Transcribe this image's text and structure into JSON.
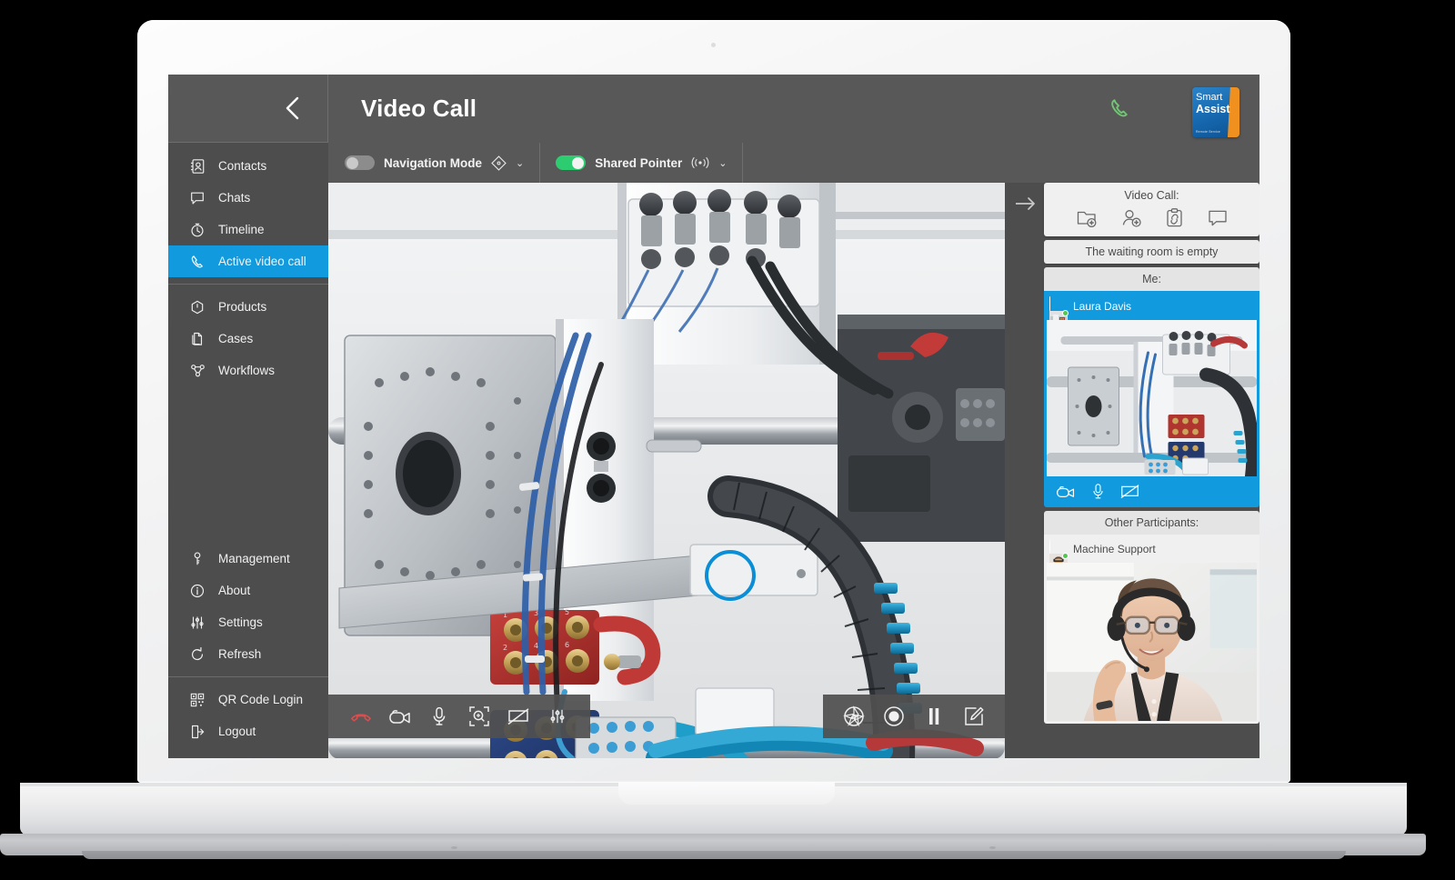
{
  "app": {
    "header": {
      "title": "Video Call",
      "back_icon": "chevron-left-icon",
      "phone_icon": "phone-active-icon",
      "logo": {
        "line1": "Smart",
        "line2": "Assist",
        "subtitle": "Remote Service"
      }
    },
    "toolbar": {
      "items": [
        {
          "label": "Navigation Mode",
          "state": "off",
          "icon": "navigation-diamond-icon",
          "chevron": "⌄"
        },
        {
          "label": "Shared Pointer",
          "state": "on",
          "icon": "pointer-waves-icon",
          "chevron": "⌄"
        }
      ]
    },
    "sidebar": {
      "primary": [
        {
          "label": "Contacts",
          "icon": "contacts-icon",
          "active": false
        },
        {
          "label": "Chats",
          "icon": "chat-bubble-icon",
          "active": false
        },
        {
          "label": "Timeline",
          "icon": "clock-icon",
          "active": false
        },
        {
          "label": "Active video call",
          "icon": "phone-handset-icon",
          "active": true
        }
      ],
      "secondary": [
        {
          "label": "Products",
          "icon": "product-hex-icon"
        },
        {
          "label": "Cases",
          "icon": "documents-icon"
        },
        {
          "label": "Workflows",
          "icon": "workflow-icon"
        }
      ],
      "tertiary": [
        {
          "label": "Management",
          "icon": "key-icon"
        },
        {
          "label": "About",
          "icon": "info-circle-icon"
        },
        {
          "label": "Settings",
          "icon": "sliders-icon"
        },
        {
          "label": "Refresh",
          "icon": "refresh-icon"
        }
      ],
      "quaternary": [
        {
          "label": "QR Code Login",
          "icon": "qr-code-icon"
        },
        {
          "label": "Logout",
          "icon": "logout-icon"
        }
      ]
    },
    "stage": {
      "collapse_arrow_icon": "arrow-right-icon",
      "pointer_marker": "shared-pointer-ring",
      "toolbar_left": [
        {
          "icon": "hangup-icon",
          "name": "end-call-button",
          "accent": "#e04c4c"
        },
        {
          "icon": "camera-icon",
          "name": "camera-toggle-button"
        },
        {
          "icon": "microphone-icon",
          "name": "microphone-toggle-button"
        },
        {
          "icon": "zoom-focus-icon",
          "name": "zoom-button"
        },
        {
          "icon": "screen-share-off-icon",
          "name": "screen-share-button"
        },
        {
          "icon": "sliders-icon",
          "name": "video-settings-button"
        }
      ],
      "toolbar_right": [
        {
          "icon": "aperture-icon",
          "name": "snapshot-button"
        },
        {
          "icon": "record-icon",
          "name": "record-button"
        },
        {
          "icon": "pause-icon",
          "name": "pause-button"
        },
        {
          "icon": "annotate-icon",
          "name": "annotate-button"
        }
      ]
    },
    "right_panel": {
      "call_card": {
        "title": "Video Call:",
        "actions": [
          {
            "icon": "new-folder-icon",
            "name": "add-folder-button"
          },
          {
            "icon": "add-person-icon",
            "name": "invite-participant-button"
          },
          {
            "icon": "copy-link-icon",
            "name": "copy-invite-link-button"
          },
          {
            "icon": "chat-bubble-icon",
            "name": "open-chat-button"
          }
        ]
      },
      "waiting_room": "The waiting room is empty",
      "me_header": "Me:",
      "me": {
        "name": "Laura Davis",
        "presence": "online",
        "controls": [
          {
            "icon": "camera-icon",
            "name": "self-camera-button"
          },
          {
            "icon": "microphone-icon",
            "name": "self-microphone-button"
          },
          {
            "icon": "screen-share-off-icon",
            "name": "self-screen-share-button"
          }
        ]
      },
      "others_header": "Other Participants:",
      "others": [
        {
          "name": "Machine Support",
          "presence": "online"
        }
      ]
    },
    "colors": {
      "accent_blue": "#119ade",
      "chrome_dark": "#4d4d4d",
      "chrome_mid": "#585858",
      "toggle_on": "#2ecc71",
      "hangup_red": "#e04c4c",
      "logo_orange": "#f0901e"
    }
  }
}
